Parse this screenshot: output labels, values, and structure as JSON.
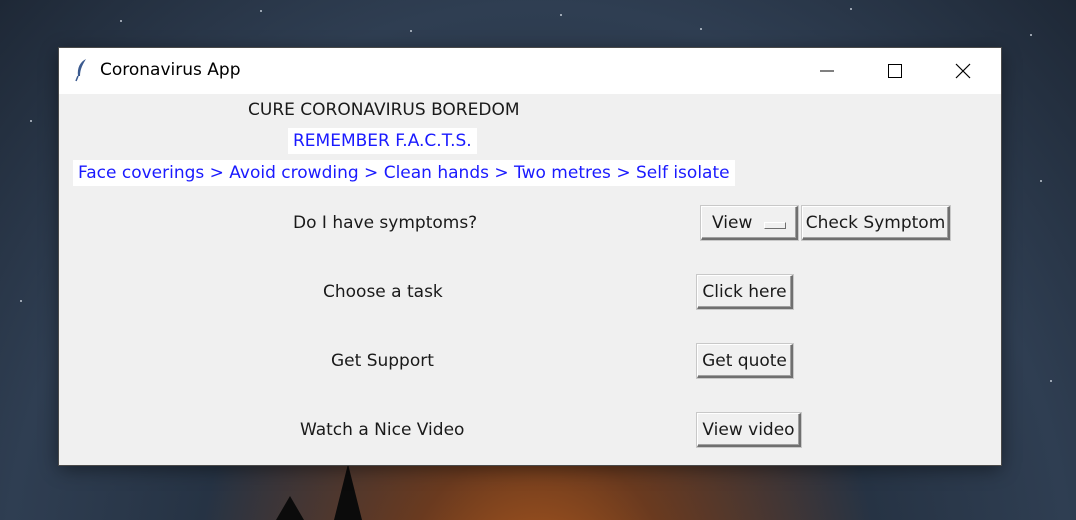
{
  "window": {
    "title": "Coronavirus App"
  },
  "content": {
    "heading": "CURE CORONAVIRUS BOREDOM",
    "remember": "REMEMBER F.A.C.T.S.",
    "facts": "Face coverings > Avoid crowding > Clean hands > Two metres > Self isolate",
    "rows": [
      {
        "label": "Do I have symptoms?"
      },
      {
        "label": "Choose a task",
        "button": "Click here"
      },
      {
        "label": "Get Support",
        "button": "Get quote"
      },
      {
        "label": "Watch a Nice Video",
        "button": "View video"
      }
    ],
    "symptom_select": "View",
    "check_symptom": "Check Symptom"
  },
  "colors": {
    "accent_text": "#1a1aff",
    "window_bg": "#f0f0f0"
  }
}
